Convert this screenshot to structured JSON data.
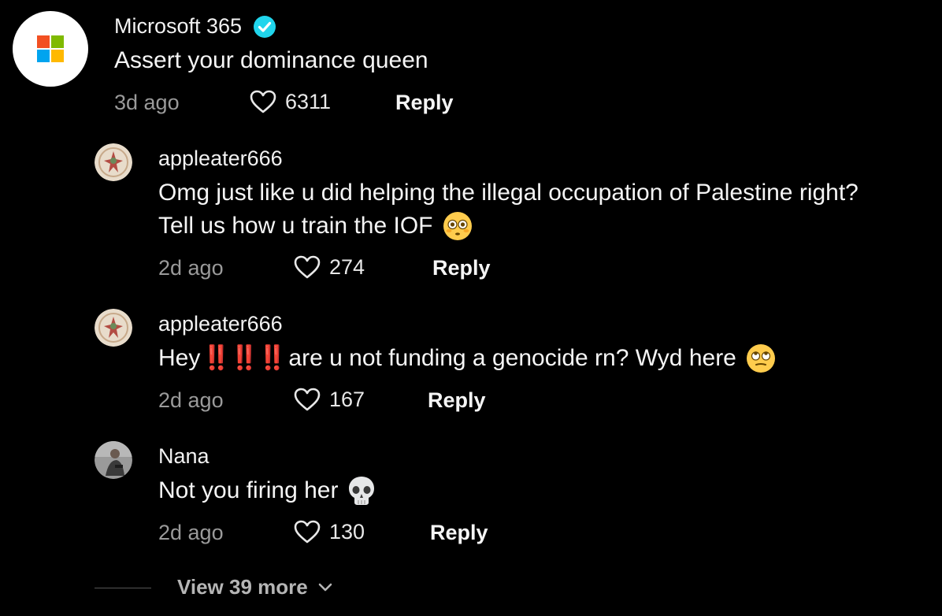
{
  "comments": [
    {
      "username": "Microsoft 365",
      "text": "Assert your dominance queen",
      "time": "3d ago",
      "likes": "6311",
      "reply_label": "Reply",
      "verified": true
    },
    {
      "username": "appleater666",
      "text_line1": "Omg just like u did helping the illegal occupation of Palestine right?",
      "text_line2": "Tell us how u train the IOF",
      "emoji": "flushed-face",
      "time": "2d ago",
      "likes": "274",
      "reply_label": "Reply"
    },
    {
      "username": "appleater666",
      "text_prefix": "Hey",
      "exclamations": "‼️‼️‼️",
      "text_suffix": "are u not funding a genocide rn? Wyd here",
      "emoji": "eye-roll-face",
      "time": "2d ago",
      "likes": "167",
      "reply_label": "Reply"
    },
    {
      "username": "Nana",
      "text": "Not you firing her",
      "emoji": "skull",
      "time": "2d ago",
      "likes": "130",
      "reply_label": "Reply"
    }
  ],
  "view_more_label": "View 39 more",
  "colors": {
    "background": "#000000",
    "verified": "#20d5ec",
    "muted": "#9a9a9a",
    "exclamation": "#e3201b"
  }
}
